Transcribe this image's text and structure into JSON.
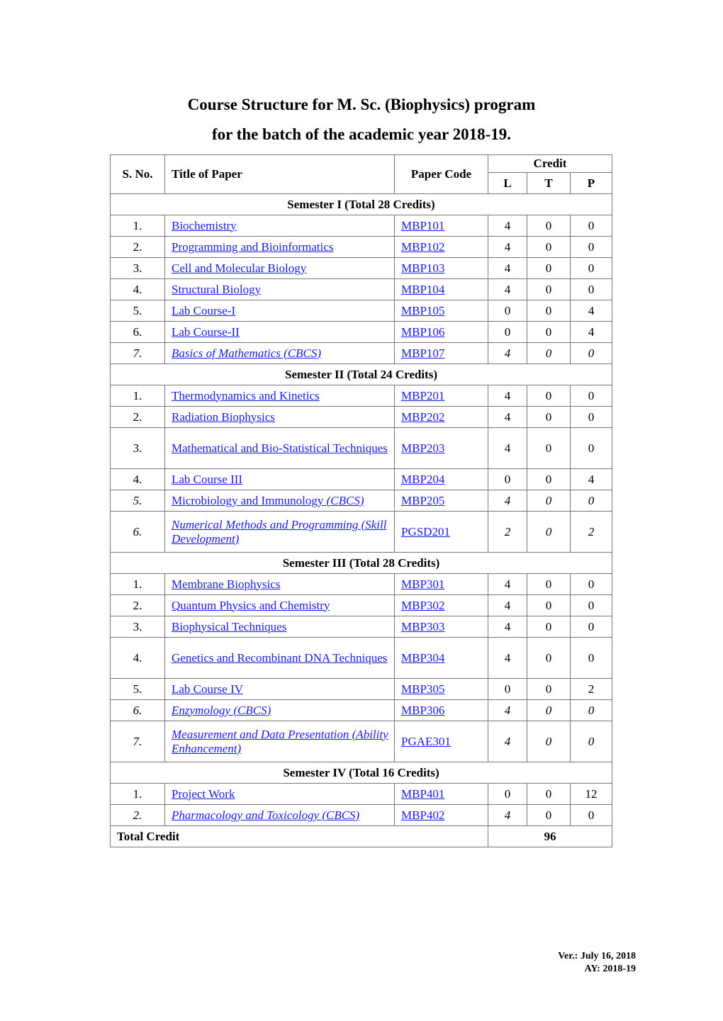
{
  "title_line1": "Course Structure for M. Sc. (Biophysics) program",
  "title_line2": "for the batch of the academic year 2018-19.",
  "headers": {
    "sno": "S. No.",
    "title": "Title of Paper",
    "code": "Paper Code",
    "credit": "Credit",
    "l": "L",
    "t": "T",
    "p": "P"
  },
  "semesters": [
    {
      "label": "Semester I (Total 28 Credits)",
      "rows": [
        {
          "sno": "1.",
          "title": "Biochemistry",
          "code": "MBP101",
          "l": "4",
          "t": "0",
          "p": "0"
        },
        {
          "sno": "2.",
          "title": "Programming and Bioinformatics",
          "code": "MBP102",
          "l": "4",
          "t": "0",
          "p": "0"
        },
        {
          "sno": "3.",
          "title": "Cell and Molecular Biology",
          "code": "MBP103",
          "l": "4",
          "t": "0",
          "p": "0"
        },
        {
          "sno": "4.",
          "title": "Structural Biology",
          "code": "MBP104",
          "l": "4",
          "t": "0",
          "p": "0"
        },
        {
          "sno": "5.",
          "title": "Lab Course-I",
          "code": "MBP105",
          "l": "0",
          "t": "0",
          "p": "4"
        },
        {
          "sno": "6.",
          "title": "Lab Course-II",
          "code": "MBP106",
          "l": "0",
          "t": "0",
          "p": "4"
        },
        {
          "sno": "7.",
          "title": "Basics of Mathematics (CBCS)",
          "code": "MBP107",
          "l": "4",
          "t": "0",
          "p": "0",
          "italic": true
        }
      ]
    },
    {
      "label": "Semester II (Total 24 Credits)",
      "rows": [
        {
          "sno": "1.",
          "title": "Thermodynamics and Kinetics",
          "code": "MBP201",
          "l": "4",
          "t": "0",
          "p": "0"
        },
        {
          "sno": "2.",
          "title": "Radiation Biophysics",
          "code": "MBP202",
          "l": "4",
          "t": "0",
          "p": "0"
        },
        {
          "sno": "3.",
          "title": "Mathematical and Bio-Statistical Techniques",
          "code": "MBP203",
          "l": "4",
          "t": "0",
          "p": "0",
          "tall": true
        },
        {
          "sno": "4.",
          "title": "Lab Course III",
          "code": "MBP204",
          "l": "0",
          "t": "0",
          "p": "4"
        },
        {
          "sno": "5.",
          "title": "Microbiology and Immunology",
          "title_suffix": "(CBCS)",
          "code": "MBP205",
          "l": "4",
          "t": "0",
          "p": "0",
          "italic_nums": true
        },
        {
          "sno": "6.",
          "title": "Numerical Methods and Programming (Skill Development)",
          "code": "PGSD201",
          "l": "2",
          "t": "0",
          "p": "2",
          "italic": true,
          "tall": true
        }
      ]
    },
    {
      "label": "Semester III (Total 28 Credits)",
      "rows": [
        {
          "sno": "1.",
          "title": "Membrane Biophysics",
          "code": "MBP301",
          "l": "4",
          "t": "0",
          "p": "0"
        },
        {
          "sno": "2.",
          "title": "Quantum Physics and Chemistry",
          "code": "MBP302",
          "l": "4",
          "t": "0",
          "p": "0"
        },
        {
          "sno": "3.",
          "title": "Biophysical Techniques",
          "code": "MBP303",
          "l": "4",
          "t": "0",
          "p": "0"
        },
        {
          "sno": "4.",
          "title": "Genetics and Recombinant DNA Techniques",
          "code": "MBP304",
          "l": "4",
          "t": "0",
          "p": "0",
          "tall": true
        },
        {
          "sno": "5.",
          "title": "Lab Course IV",
          "code": "MBP305",
          "l": "0",
          "t": "0",
          "p": "2"
        },
        {
          "sno": "6.",
          "title": "Enzymology (CBCS)",
          "code": "MBP306",
          "l": "4",
          "t": "0",
          "p": "0",
          "italic": true
        },
        {
          "sno": "7.",
          "title": "Measurement and Data Presentation (Ability Enhancement)",
          "code": "PGAE301",
          "l": "4",
          "t": "0",
          "p": "0",
          "italic": true,
          "tall": true
        }
      ]
    },
    {
      "label": "Semester IV (Total 16 Credits)",
      "rows": [
        {
          "sno": "1.",
          "title": "Project Work",
          "code": "MBP401",
          "l": "0",
          "t": "0",
          "p": "12"
        },
        {
          "sno": "2.",
          "title": "Pharmacology and Toxicology (CBCS)",
          "code": "MBP402",
          "l": "4",
          "t": "0",
          "p": "0",
          "italic": true,
          "italic_l_only": true
        }
      ]
    }
  ],
  "total": {
    "label": "Total Credit",
    "value": "96"
  },
  "footer": {
    "version": "Ver.: July 16, 2018",
    "ay": "AY: 2018-19"
  }
}
